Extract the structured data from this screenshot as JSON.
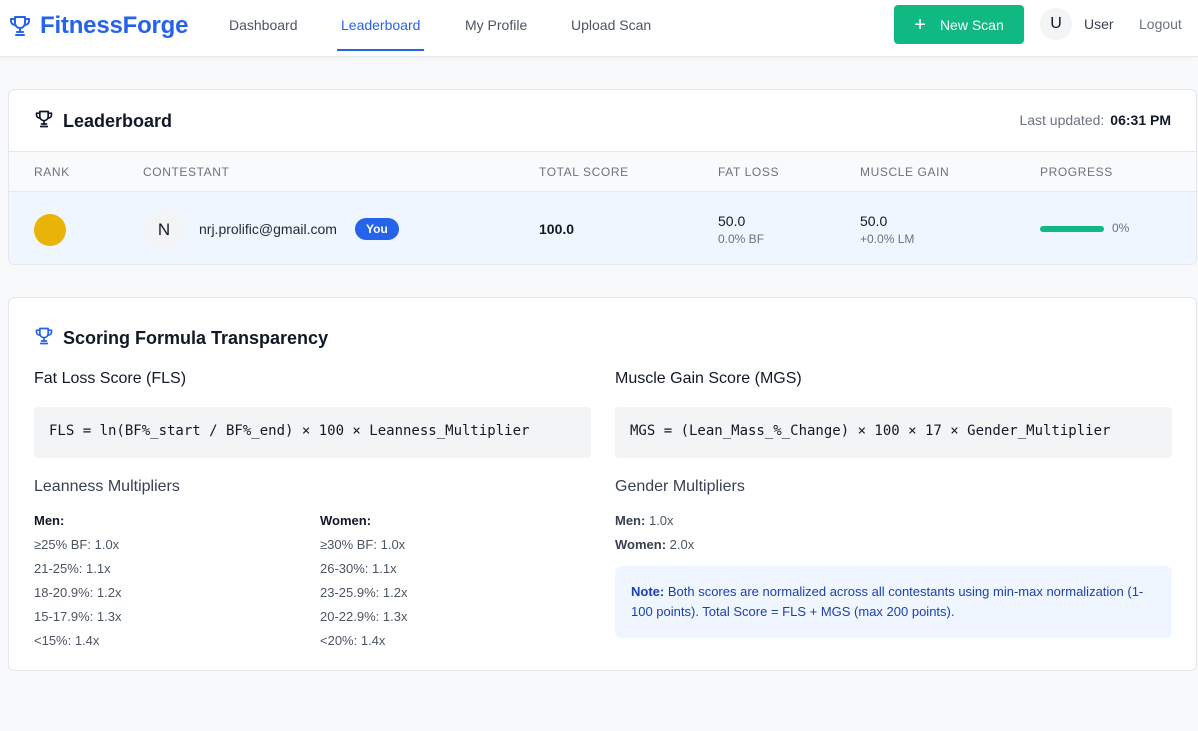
{
  "app": {
    "name": "FitnessForge"
  },
  "nav": {
    "links": [
      {
        "label": "Dashboard"
      },
      {
        "label": "Leaderboard"
      },
      {
        "label": "My Profile"
      },
      {
        "label": "Upload Scan"
      }
    ],
    "new_scan": "New Scan",
    "user_initial": "U",
    "user_name": "User",
    "logout": "Logout"
  },
  "leaderboard": {
    "title": "Leaderboard",
    "last_updated_label": "Last updated:",
    "last_updated_time": "06:31 PM",
    "columns": [
      "Rank",
      "Contestant",
      "Total Score",
      "Fat Loss",
      "Muscle Gain",
      "Progress"
    ],
    "rows": [
      {
        "avatar_initial": "N",
        "email": "nrj.prolific@gmail.com",
        "badge": "You",
        "total_score": "100.0",
        "fat_loss": "50.0",
        "fat_loss_sub": "0.0% BF",
        "muscle_gain": "50.0",
        "muscle_gain_sub": "+0.0% LM",
        "progress_label": "0%",
        "rank_color": "#eab308"
      }
    ]
  },
  "scoring": {
    "title": "Scoring Formula Transparency",
    "fls_heading": "Fat Loss Score (FLS)",
    "fls_formula": "FLS = ln(BF%_start / BF%_end) × 100 × Leanness_Multiplier",
    "mgs_heading": "Muscle Gain Score (MGS)",
    "mgs_formula": "MGS = (Lean_Mass_%_Change) × 100 × 17 × Gender_Multiplier",
    "leanness_heading": "Leanness Multipliers",
    "men_heading": "Men:",
    "men": [
      "≥25% BF: 1.0x",
      "21-25%: 1.1x",
      "18-20.9%: 1.2x",
      "15-17.9%: 1.3x",
      "<15%: 1.4x"
    ],
    "women_heading": "Women:",
    "women": [
      "≥30% BF: 1.0x",
      "26-30%: 1.1x",
      "23-25.9%: 1.2x",
      "20-22.9%: 1.3x",
      "<20%: 1.4x"
    ],
    "gender_heading": "Gender Multipliers",
    "gender_men_label": "Men:",
    "gender_men_value": "1.0x",
    "gender_women_label": "Women:",
    "gender_women_value": "2.0x",
    "note_label": "Note:",
    "note_text": "Both scores are normalized across all contestants using min-max normalization (1-100 points). Total Score = FLS + MGS (max 200 points)."
  },
  "colors": {
    "accent": "#2563eb",
    "success": "#10b981",
    "gold": "#eab308"
  }
}
